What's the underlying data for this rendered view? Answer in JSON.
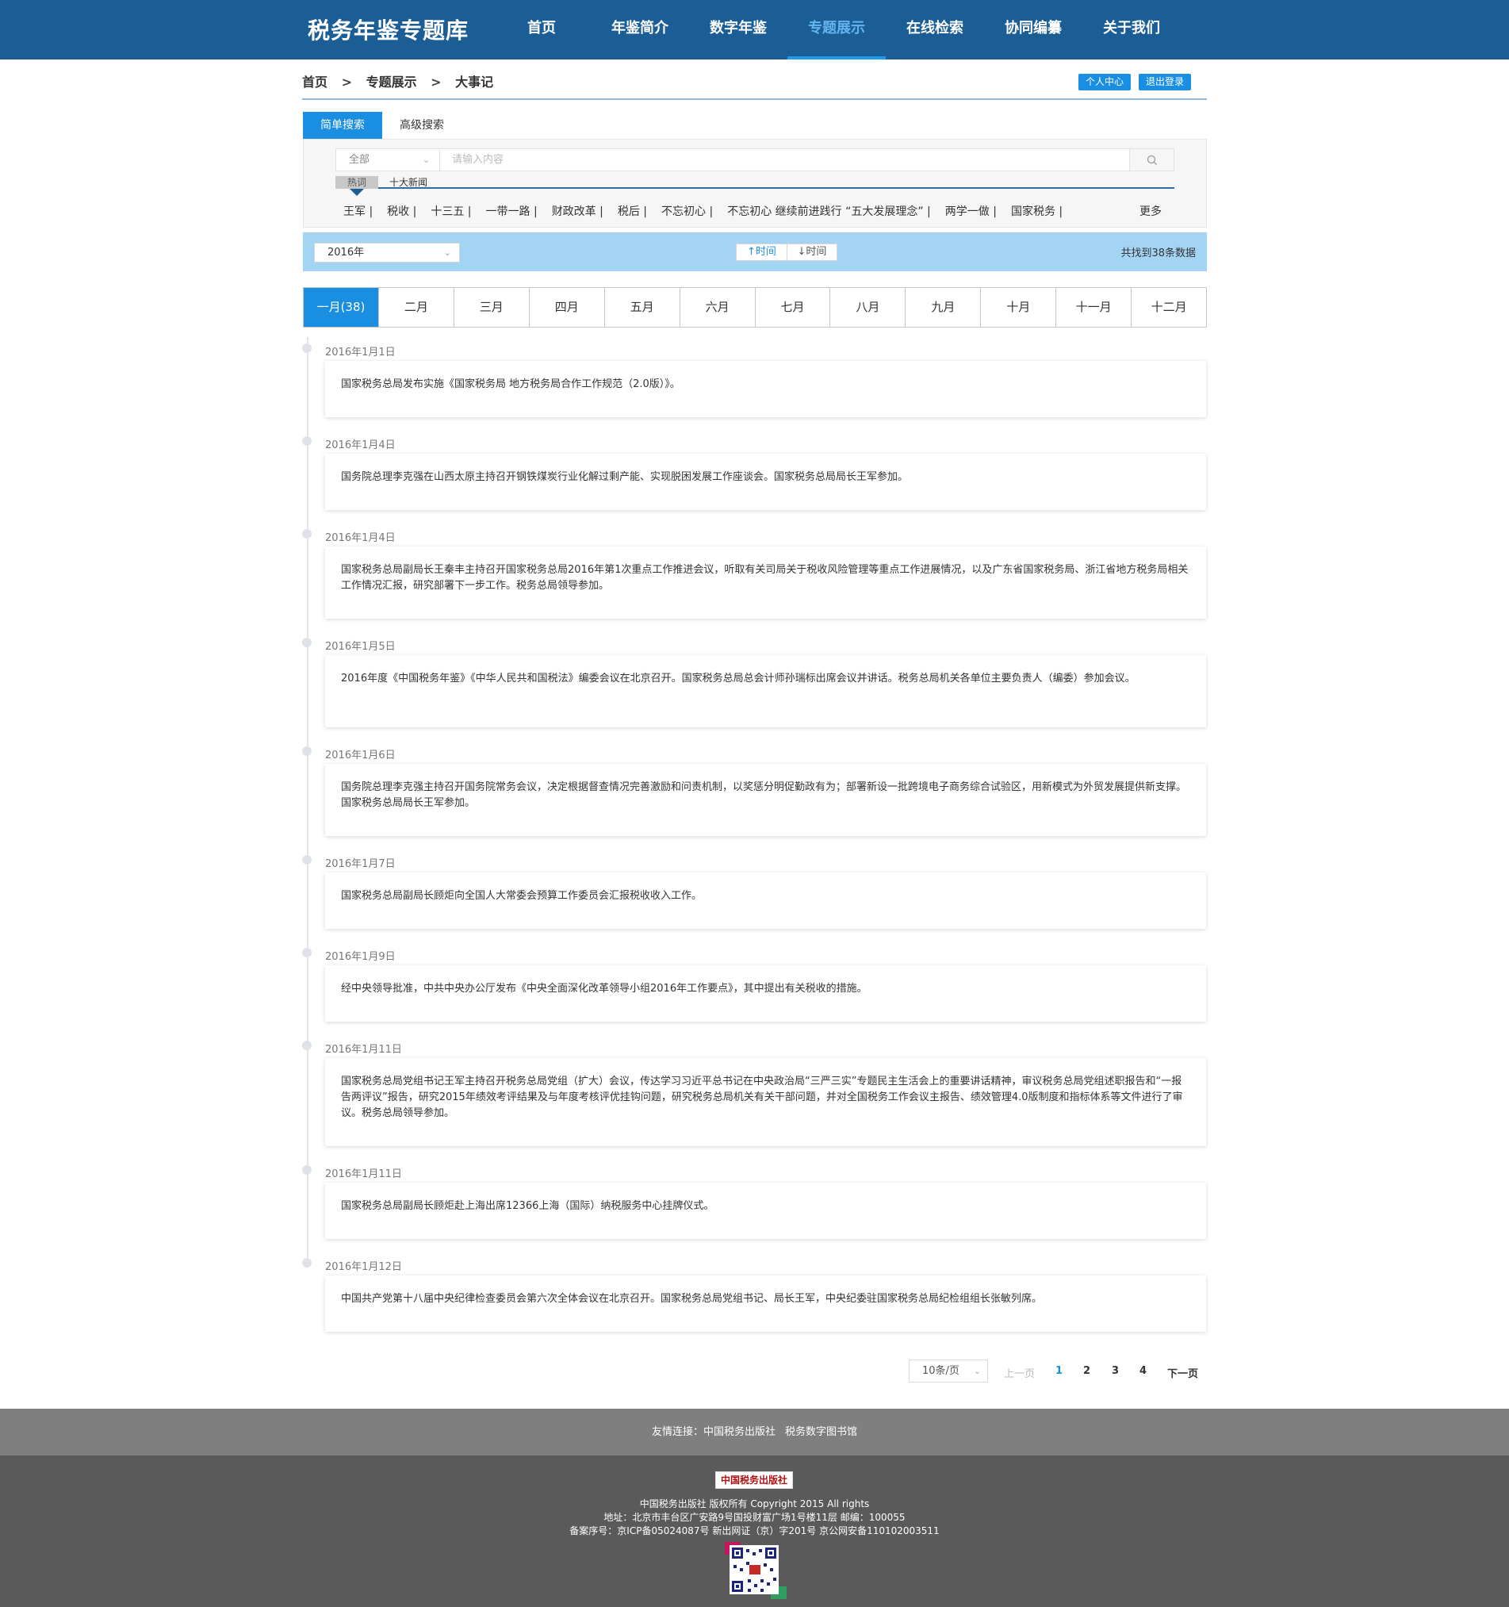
{
  "header": {
    "logo": "税务年鉴专题库",
    "nav": [
      "首页",
      "年鉴简介",
      "数字年鉴",
      "专题展示",
      "在线检索",
      "协同编纂",
      "关于我们"
    ],
    "active_nav": "专题展示"
  },
  "breadcrumb": {
    "items": [
      "首页",
      "专题展示",
      "大事记"
    ],
    "separator": ">",
    "user_center": "个人中心",
    "logout": "退出登录"
  },
  "search": {
    "tabs": [
      "简单搜索",
      "高级搜索"
    ],
    "scope": "全部",
    "placeholder": "请输入内容",
    "hot_tabs": [
      "热词",
      "十大新闻"
    ],
    "hot_words": [
      "王军 |",
      "税收 |",
      "十三五 |",
      "一带一路 |",
      "财政改革 |",
      "税后 |",
      "不忘初心 |",
      "不忘初心 继续前进践行 “五大发展理念” |",
      "两学一做 |",
      "国家税务 |"
    ],
    "more": "更多"
  },
  "filter": {
    "year": "2016年",
    "sort_asc": "↑时间",
    "sort_desc": "↓时间",
    "total": "共找到38条数据"
  },
  "months": [
    "一月(38)",
    "二月",
    "三月",
    "四月",
    "五月",
    "六月",
    "七月",
    "八月",
    "九月",
    "十月",
    "十一月",
    "十二月"
  ],
  "events": [
    {
      "date": "2016年1月1日",
      "text": "国家税务总局发布实施《国家税务局 地方税务局合作工作规范（2.0版）》。"
    },
    {
      "date": "2016年1月4日",
      "text": "国务院总理李克强在山西太原主持召开钢铁煤炭行业化解过剩产能、实现脱困发展工作座谈会。国家税务总局局长王军参加。"
    },
    {
      "date": "2016年1月4日",
      "text": "国家税务总局副局长王秦丰主持召开国家税务总局2016年第1次重点工作推进会议，听取有关司局关于税收风险管理等重点工作进展情况，以及广东省国家税务局、浙江省地方税务局相关工作情况汇报，研究部署下一步工作。税务总局领导参加。"
    },
    {
      "date": "2016年1月5日",
      "text": "2016年度《中国税务年鉴》《中华人民共和国税法》编委会议在北京召开。国家税务总局总会计师孙瑞标出席会议并讲话。税务总局机关各单位主要负责人（编委）参加会议。"
    },
    {
      "date": "2016年1月6日",
      "text": "国务院总理李克强主持召开国务院常务会议，决定根据督查情况完善激励和问责机制，以奖惩分明促勤政有为；部署新设一批跨境电子商务综合试验区，用新模式为外贸发展提供新支撑。国家税务总局局长王军参加。"
    },
    {
      "date": "2016年1月7日",
      "text": "国家税务总局副局长顾炬向全国人大常委会预算工作委员会汇报税收收入工作。"
    },
    {
      "date": "2016年1月9日",
      "text": "经中央领导批准，中共中央办公厅发布《中央全面深化改革领导小组2016年工作要点》，其中提出有关税收的措施。"
    },
    {
      "date": "2016年1月11日",
      "text": "国家税务总局党组书记王军主持召开税务总局党组（扩大）会议，传达学习习近平总书记在中央政治局“三严三实”专题民主生活会上的重要讲话精神，审议税务总局党组述职报告和“一报告两评议”报告，研究2015年绩效考评结果及与年度考核评优挂钩问题，研究税务总局机关有关干部问题，并对全国税务工作会议主报告、绩效管理4.0版制度和指标体系等文件进行了审议。税务总局领导参加。"
    },
    {
      "date": "2016年1月11日",
      "text": "国家税务总局副局长顾炬赴上海出席12366上海（国际）纳税服务中心挂牌仪式。"
    },
    {
      "date": "2016年1月12日",
      "text": "中国共产党第十八届中央纪律检查委员会第六次全体会议在北京召开。国家税务总局党组书记、局长王军，中央纪委驻国家税务总局纪检组组长张敏列席。"
    }
  ],
  "pagination": {
    "per_page": "10条/页",
    "prev": "上一页",
    "pages": [
      "1",
      "2",
      "3",
      "4"
    ],
    "current": "1",
    "next": "下一页"
  },
  "footer": {
    "links_label": "友情连接：",
    "links": [
      "中国税务出版社",
      "税务数字图书馆"
    ],
    "publisher_logo": "中国税务出版社",
    "copyright": "中国税务出版社 版权所有 Copyright 2015 All rights",
    "address": "地址：北京市丰台区广安路9号国投财富广场1号楼11层 邮编：100055",
    "record": "备案序号：京ICP备05024087号   新出网证（京）字201号   京公网安备110102003511"
  },
  "colors": {
    "header_bg": "#1b5e96",
    "accent": "#1a8ee1",
    "filter_bg": "#a3d4f3",
    "footer_links_bg": "#7f7f7f",
    "footer_bg": "#5a5a5a"
  }
}
